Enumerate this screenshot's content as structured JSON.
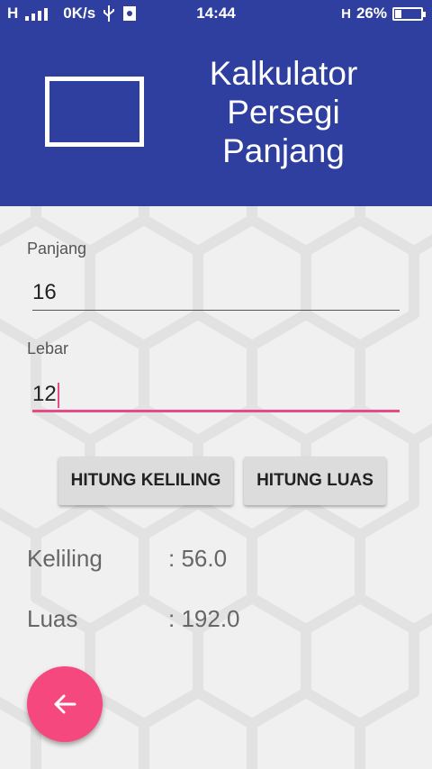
{
  "status_bar": {
    "network": "H",
    "speed": "0K/s",
    "time": "14:44",
    "data_type": "H",
    "battery_percent": "26%",
    "battery_level": 0.26
  },
  "header": {
    "title": "Kalkulator Persegi Panjang",
    "background_color": "#2f3f9f"
  },
  "form": {
    "panjang_label": "Panjang",
    "panjang_value": "16",
    "lebar_label": "Lebar",
    "lebar_value": "12"
  },
  "buttons": {
    "keliling": "HITUNG KELILING",
    "luas": "HITUNG LUAS"
  },
  "results": {
    "keliling_label": "Keliling",
    "keliling_value": ": 56.0",
    "luas_label": "Luas",
    "luas_value": ": 192.0"
  },
  "fab": {
    "icon": "arrow-back-icon",
    "color": "#f5487f"
  },
  "accent_color": "#e84a86"
}
